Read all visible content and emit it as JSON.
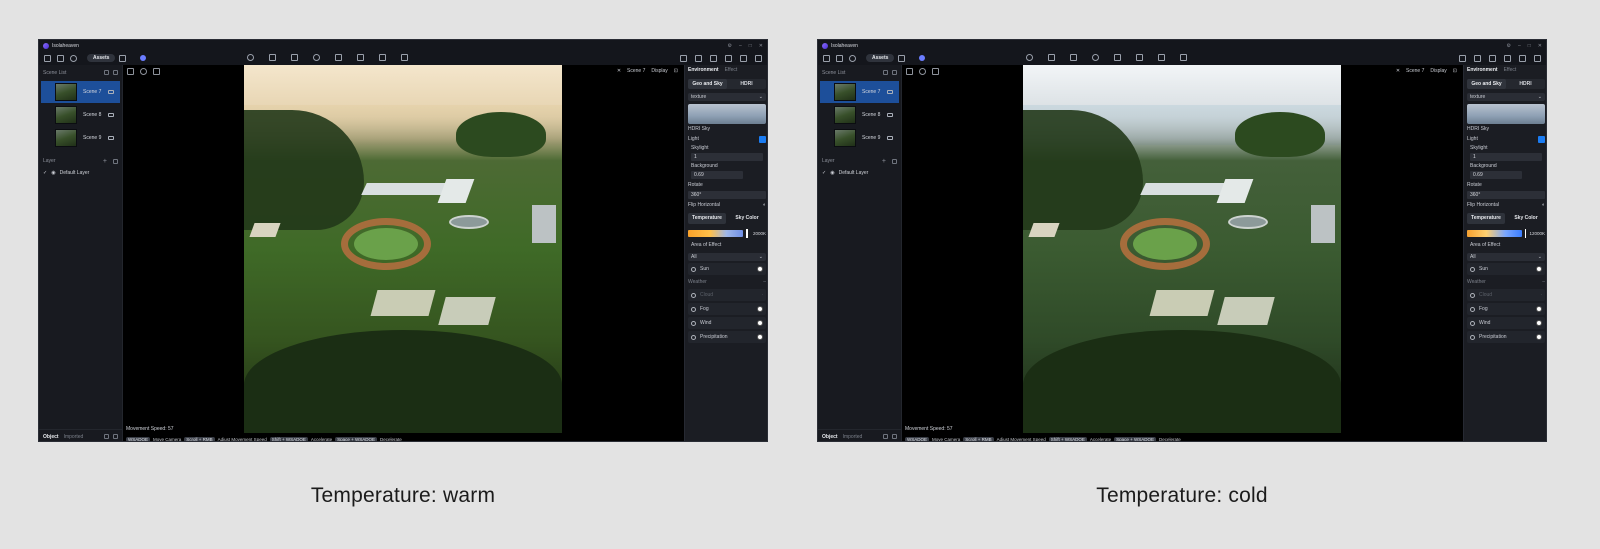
{
  "app": {
    "name": "Isolaheaven"
  },
  "toolbar": {
    "assets_label": "Assets"
  },
  "left_panel": {
    "scene_list_label": "Scene List",
    "scenes": [
      {
        "name": "Scene 7"
      },
      {
        "name": "Scene 8"
      },
      {
        "name": "Scene 9"
      }
    ],
    "layer_label": "Layer",
    "default_layer": "Default Layer",
    "footer_tabs": [
      "Object",
      "Imported"
    ]
  },
  "viewport": {
    "scene_label": "Scene 7",
    "display_label": "Display",
    "movement_speed": "Movement Speed: 57",
    "keys": [
      {
        "key": "WSADQE",
        "action": "Move Camera"
      },
      {
        "key": "Scroll + RMB",
        "action": "Adjust Movement Speed"
      },
      {
        "key": "Shift + WSADQE",
        "action": "Accelerate"
      },
      {
        "key": "Space + WSADQE",
        "action": "Decelerate"
      }
    ]
  },
  "right_panel": {
    "tabs": [
      "Environment",
      "Effect"
    ],
    "seg": [
      "Geo and Sky",
      "HDRI"
    ],
    "texture_select": "texture",
    "hdri_sky_label": "HDRI Sky",
    "light_label": "Light",
    "skylight_label": "Skylight",
    "skylight_value": "1",
    "background_label": "Background",
    "background_value": "0.69",
    "rotate_label": "Rotate",
    "rotate_value": "360°",
    "flip_label": "Flip Horizontal",
    "duo": [
      "Temperature",
      "Sky Color"
    ],
    "area_label": "Area of Effect",
    "area_value": "All",
    "sun_label": "Sun",
    "weather_label": "Weather",
    "weather_items": [
      "Cloud",
      "Fog",
      "Wind",
      "Precipitation"
    ]
  },
  "panels": [
    {
      "variant": "warm",
      "temperature_value": "2000K",
      "caption": "Temperature: warm"
    },
    {
      "variant": "cold",
      "temperature_value": "12000K",
      "caption": "Temperature: cold"
    }
  ],
  "colors": {
    "selection": "#1d4f9a",
    "accent": "#1b7cf2",
    "page_bg": "#e3e3e3"
  }
}
